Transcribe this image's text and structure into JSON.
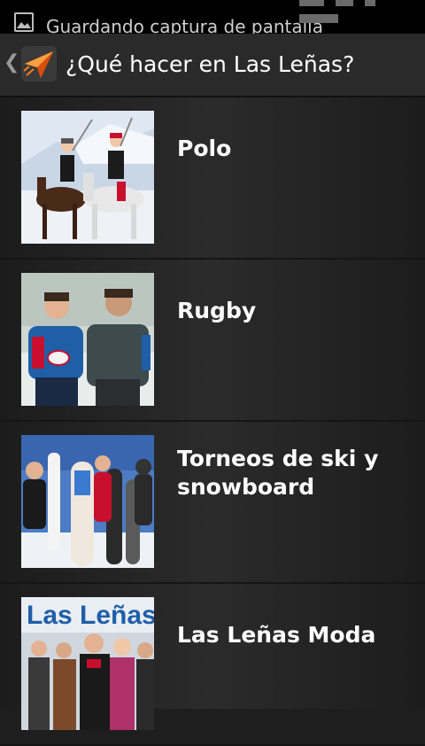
{
  "status_bar": {
    "notification_text": "Guardando captura de pantalla",
    "notification_icon": "image-icon"
  },
  "action_bar": {
    "up_icon": "chevron-left-icon",
    "app_icon": "paper-plane-icon",
    "title": "¿Qué hacer en Las Leñas?"
  },
  "items": [
    {
      "label": "Polo",
      "image": "polo-photo"
    },
    {
      "label": "Rugby",
      "image": "rugby-photo"
    },
    {
      "label": "Torneos de ski y snowboard",
      "image": "ski-snowboard-photo"
    },
    {
      "label": "Las Leñas Moda",
      "image": "fashion-photo",
      "image_text": "Las Leñas"
    }
  ],
  "colors": {
    "background": "#1e1e1e",
    "action_bar": "#2a2a2a",
    "app_icon_accent": "#ff7a1a"
  }
}
